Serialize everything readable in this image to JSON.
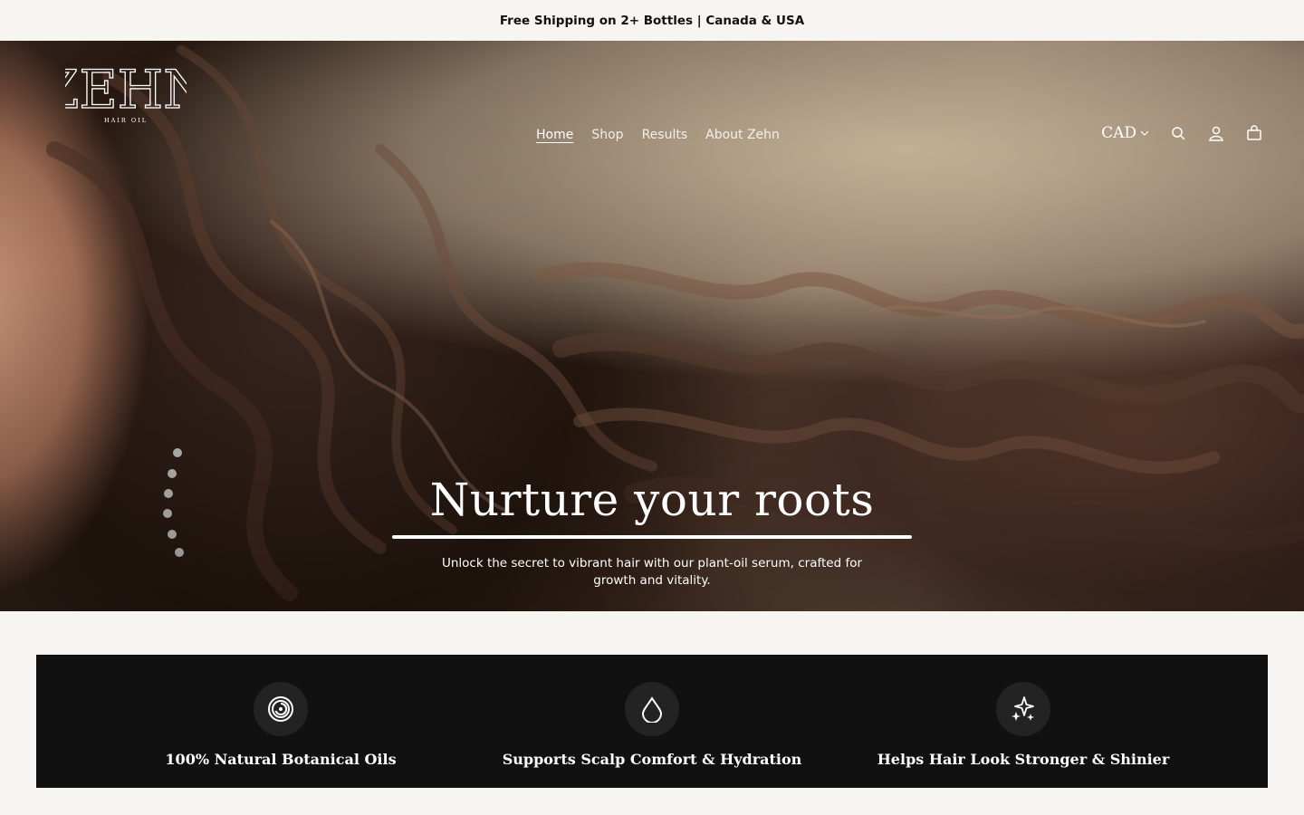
{
  "announcement": {
    "text": "Free Shipping on 2+ Bottles | Canada & USA"
  },
  "header": {
    "logo_text": "ZEHN",
    "logo_subtitle": "HAIR OIL",
    "nav": [
      {
        "label": "Home",
        "active": true
      },
      {
        "label": "Shop",
        "active": false
      },
      {
        "label": "Results",
        "active": false
      },
      {
        "label": "About Zehn",
        "active": false
      }
    ],
    "currency": "CAD",
    "icons": [
      "search-icon",
      "account-icon",
      "cart-icon"
    ]
  },
  "hero": {
    "title": "Nurture your roots",
    "subtitle": "Unlock the secret to vibrant hair with our plant-oil serum, crafted for growth and vitality."
  },
  "features": [
    {
      "icon": "spiral-icon",
      "label": "100% Natural Botanical Oils"
    },
    {
      "icon": "droplet-icon",
      "label": "Supports Scalp Comfort & Hydration"
    },
    {
      "icon": "sparkles-icon",
      "label": "Helps Hair Look Stronger & Shinier"
    }
  ],
  "colors": {
    "page_bg": "#f6f5f1",
    "feature_bar_bg": "#111112",
    "feature_icon_bg": "#232324",
    "text_light": "#ffffff",
    "text_dark": "#111111"
  }
}
